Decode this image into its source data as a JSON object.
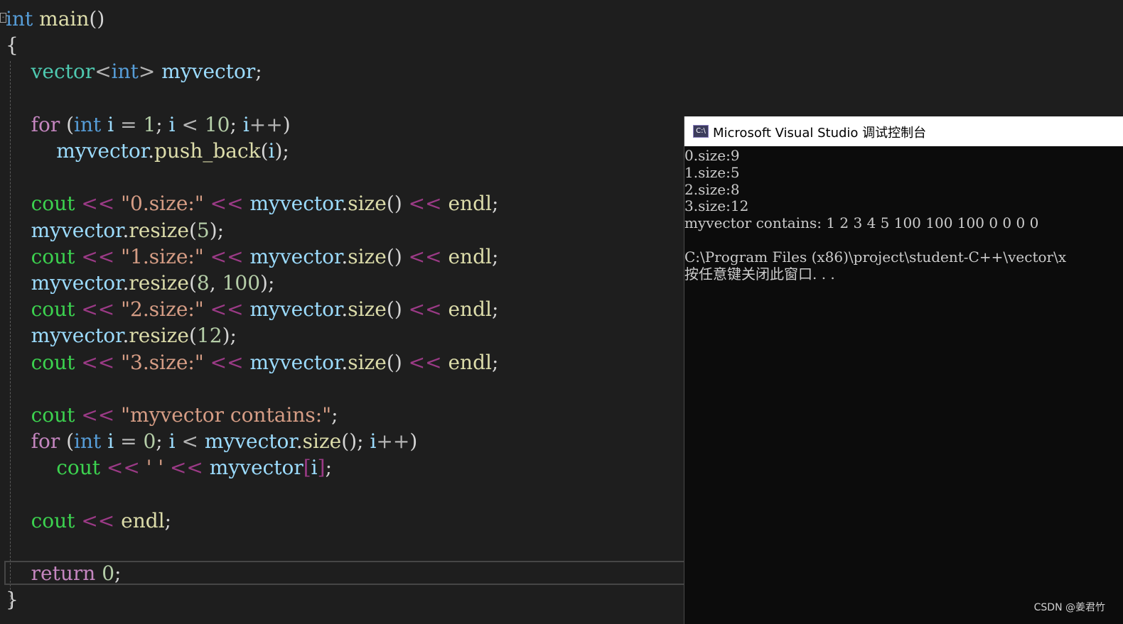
{
  "editor": {
    "fold_marker": "-",
    "lines": [
      {
        "tokens": [
          {
            "t": "int",
            "c": "t-kw"
          },
          {
            "t": " ",
            "c": "t-punc"
          },
          {
            "t": "main",
            "c": "t-fn"
          },
          {
            "t": "()",
            "c": "t-punc"
          }
        ]
      },
      {
        "tokens": [
          {
            "t": "{",
            "c": "t-punc"
          }
        ]
      },
      {
        "tokens": [
          {
            "t": "    ",
            "c": "t-punc"
          },
          {
            "t": "vector",
            "c": "t-id"
          },
          {
            "t": "<",
            "c": "t-op"
          },
          {
            "t": "int",
            "c": "t-kw"
          },
          {
            "t": ">",
            "c": "t-op"
          },
          {
            "t": " myvector",
            "c": "t-var"
          },
          {
            "t": ";",
            "c": "t-punc"
          }
        ]
      },
      {
        "tokens": [
          {
            "t": "",
            "c": "t-punc"
          }
        ]
      },
      {
        "tokens": [
          {
            "t": "    ",
            "c": "t-punc"
          },
          {
            "t": "for",
            "c": "t-for"
          },
          {
            "t": " (",
            "c": "t-punc"
          },
          {
            "t": "int",
            "c": "t-kw"
          },
          {
            "t": " i ",
            "c": "t-var"
          },
          {
            "t": "=",
            "c": "t-op"
          },
          {
            "t": " ",
            "c": "t-punc"
          },
          {
            "t": "1",
            "c": "t-num"
          },
          {
            "t": "; ",
            "c": "t-punc"
          },
          {
            "t": "i",
            "c": "t-var"
          },
          {
            "t": " < ",
            "c": "t-op"
          },
          {
            "t": "10",
            "c": "t-num"
          },
          {
            "t": "; ",
            "c": "t-punc"
          },
          {
            "t": "i",
            "c": "t-var"
          },
          {
            "t": "++",
            "c": "t-op"
          },
          {
            "t": ")",
            "c": "t-punc"
          }
        ]
      },
      {
        "tokens": [
          {
            "t": "        ",
            "c": "t-punc"
          },
          {
            "t": "myvector",
            "c": "t-var"
          },
          {
            "t": ".",
            "c": "t-punc"
          },
          {
            "t": "push_back",
            "c": "t-fn"
          },
          {
            "t": "(",
            "c": "t-punc"
          },
          {
            "t": "i",
            "c": "t-var"
          },
          {
            "t": ");",
            "c": "t-punc"
          }
        ]
      },
      {
        "tokens": [
          {
            "t": "",
            "c": "t-punc"
          }
        ]
      },
      {
        "tokens": [
          {
            "t": "    ",
            "c": "t-punc"
          },
          {
            "t": "cout",
            "c": "t-cout"
          },
          {
            "t": " << ",
            "c": "t-shift"
          },
          {
            "t": "\"0.size:\"",
            "c": "t-str"
          },
          {
            "t": " << ",
            "c": "t-shift"
          },
          {
            "t": "myvector",
            "c": "t-var"
          },
          {
            "t": ".",
            "c": "t-punc"
          },
          {
            "t": "size",
            "c": "t-fn"
          },
          {
            "t": "()",
            "c": "t-punc"
          },
          {
            "t": " << ",
            "c": "t-shift"
          },
          {
            "t": "endl",
            "c": "t-endl"
          },
          {
            "t": ";",
            "c": "t-punc"
          }
        ]
      },
      {
        "tokens": [
          {
            "t": "    ",
            "c": "t-punc"
          },
          {
            "t": "myvector",
            "c": "t-var"
          },
          {
            "t": ".",
            "c": "t-punc"
          },
          {
            "t": "resize",
            "c": "t-fn"
          },
          {
            "t": "(",
            "c": "t-punc"
          },
          {
            "t": "5",
            "c": "t-num"
          },
          {
            "t": ");",
            "c": "t-punc"
          }
        ]
      },
      {
        "tokens": [
          {
            "t": "    ",
            "c": "t-punc"
          },
          {
            "t": "cout",
            "c": "t-cout"
          },
          {
            "t": " << ",
            "c": "t-shift"
          },
          {
            "t": "\"1.size:\"",
            "c": "t-str"
          },
          {
            "t": " << ",
            "c": "t-shift"
          },
          {
            "t": "myvector",
            "c": "t-var"
          },
          {
            "t": ".",
            "c": "t-punc"
          },
          {
            "t": "size",
            "c": "t-fn"
          },
          {
            "t": "()",
            "c": "t-punc"
          },
          {
            "t": " << ",
            "c": "t-shift"
          },
          {
            "t": "endl",
            "c": "t-endl"
          },
          {
            "t": ";",
            "c": "t-punc"
          }
        ]
      },
      {
        "tokens": [
          {
            "t": "    ",
            "c": "t-punc"
          },
          {
            "t": "myvector",
            "c": "t-var"
          },
          {
            "t": ".",
            "c": "t-punc"
          },
          {
            "t": "resize",
            "c": "t-fn"
          },
          {
            "t": "(",
            "c": "t-punc"
          },
          {
            "t": "8",
            "c": "t-num"
          },
          {
            "t": ", ",
            "c": "t-punc"
          },
          {
            "t": "100",
            "c": "t-num"
          },
          {
            "t": ");",
            "c": "t-punc"
          }
        ]
      },
      {
        "tokens": [
          {
            "t": "    ",
            "c": "t-punc"
          },
          {
            "t": "cout",
            "c": "t-cout"
          },
          {
            "t": " << ",
            "c": "t-shift"
          },
          {
            "t": "\"2.size:\"",
            "c": "t-str"
          },
          {
            "t": " << ",
            "c": "t-shift"
          },
          {
            "t": "myvector",
            "c": "t-var"
          },
          {
            "t": ".",
            "c": "t-punc"
          },
          {
            "t": "size",
            "c": "t-fn"
          },
          {
            "t": "()",
            "c": "t-punc"
          },
          {
            "t": " << ",
            "c": "t-shift"
          },
          {
            "t": "endl",
            "c": "t-endl"
          },
          {
            "t": ";",
            "c": "t-punc"
          }
        ]
      },
      {
        "tokens": [
          {
            "t": "    ",
            "c": "t-punc"
          },
          {
            "t": "myvector",
            "c": "t-var"
          },
          {
            "t": ".",
            "c": "t-punc"
          },
          {
            "t": "resize",
            "c": "t-fn"
          },
          {
            "t": "(",
            "c": "t-punc"
          },
          {
            "t": "12",
            "c": "t-num"
          },
          {
            "t": ");",
            "c": "t-punc"
          }
        ]
      },
      {
        "tokens": [
          {
            "t": "    ",
            "c": "t-punc"
          },
          {
            "t": "cout",
            "c": "t-cout"
          },
          {
            "t": " << ",
            "c": "t-shift"
          },
          {
            "t": "\"3.size:\"",
            "c": "t-str"
          },
          {
            "t": " << ",
            "c": "t-shift"
          },
          {
            "t": "myvector",
            "c": "t-var"
          },
          {
            "t": ".",
            "c": "t-punc"
          },
          {
            "t": "size",
            "c": "t-fn"
          },
          {
            "t": "()",
            "c": "t-punc"
          },
          {
            "t": " << ",
            "c": "t-shift"
          },
          {
            "t": "endl",
            "c": "t-endl"
          },
          {
            "t": ";",
            "c": "t-punc"
          }
        ]
      },
      {
        "tokens": [
          {
            "t": "",
            "c": "t-punc"
          }
        ]
      },
      {
        "tokens": [
          {
            "t": "    ",
            "c": "t-punc"
          },
          {
            "t": "cout",
            "c": "t-cout"
          },
          {
            "t": " << ",
            "c": "t-shift"
          },
          {
            "t": "\"myvector contains:\"",
            "c": "t-str"
          },
          {
            "t": ";",
            "c": "t-punc"
          }
        ]
      },
      {
        "tokens": [
          {
            "t": "    ",
            "c": "t-punc"
          },
          {
            "t": "for",
            "c": "t-for"
          },
          {
            "t": " (",
            "c": "t-punc"
          },
          {
            "t": "int",
            "c": "t-kw"
          },
          {
            "t": " i ",
            "c": "t-var"
          },
          {
            "t": "=",
            "c": "t-op"
          },
          {
            "t": " ",
            "c": "t-punc"
          },
          {
            "t": "0",
            "c": "t-num"
          },
          {
            "t": "; ",
            "c": "t-punc"
          },
          {
            "t": "i",
            "c": "t-var"
          },
          {
            "t": " < ",
            "c": "t-op"
          },
          {
            "t": "myvector",
            "c": "t-var"
          },
          {
            "t": ".",
            "c": "t-punc"
          },
          {
            "t": "size",
            "c": "t-fn"
          },
          {
            "t": "(); ",
            "c": "t-punc"
          },
          {
            "t": "i",
            "c": "t-var"
          },
          {
            "t": "++",
            "c": "t-op"
          },
          {
            "t": ")",
            "c": "t-punc"
          }
        ]
      },
      {
        "tokens": [
          {
            "t": "        ",
            "c": "t-punc"
          },
          {
            "t": "cout",
            "c": "t-cout"
          },
          {
            "t": " << ",
            "c": "t-shift"
          },
          {
            "t": "' '",
            "c": "t-str"
          },
          {
            "t": " << ",
            "c": "t-shift"
          },
          {
            "t": "myvector",
            "c": "t-var"
          },
          {
            "t": "[",
            "c": "t-shift"
          },
          {
            "t": "i",
            "c": "t-var"
          },
          {
            "t": "]",
            "c": "t-shift"
          },
          {
            "t": ";",
            "c": "t-punc"
          }
        ]
      },
      {
        "tokens": [
          {
            "t": "",
            "c": "t-punc"
          }
        ]
      },
      {
        "tokens": [
          {
            "t": "    ",
            "c": "t-punc"
          },
          {
            "t": "cout",
            "c": "t-cout"
          },
          {
            "t": " << ",
            "c": "t-shift"
          },
          {
            "t": "endl",
            "c": "t-endl"
          },
          {
            "t": ";",
            "c": "t-punc"
          }
        ]
      },
      {
        "tokens": [
          {
            "t": "",
            "c": "t-punc"
          }
        ]
      },
      {
        "tokens": [
          {
            "t": "    ",
            "c": "t-punc"
          },
          {
            "t": "return",
            "c": "t-ret"
          },
          {
            "t": " ",
            "c": "t-punc"
          },
          {
            "t": "0",
            "c": "t-num"
          },
          {
            "t": ";",
            "c": "t-punc"
          }
        ]
      },
      {
        "tokens": [
          {
            "t": "}",
            "c": "t-punc"
          }
        ]
      }
    ]
  },
  "console": {
    "icon_label": "C:\\",
    "title": "Microsoft Visual Studio 调试控制台",
    "lines": [
      "0.size:9",
      "1.size:5",
      "2.size:8",
      "3.size:12",
      "myvector contains: 1 2 3 4 5 100 100 100 0 0 0 0",
      "",
      "C:\\Program Files (x86)\\project\\student-C++\\vector\\x",
      "按任意键关闭此窗口. . ."
    ]
  },
  "watermark": "CSDN @姜君竹"
}
